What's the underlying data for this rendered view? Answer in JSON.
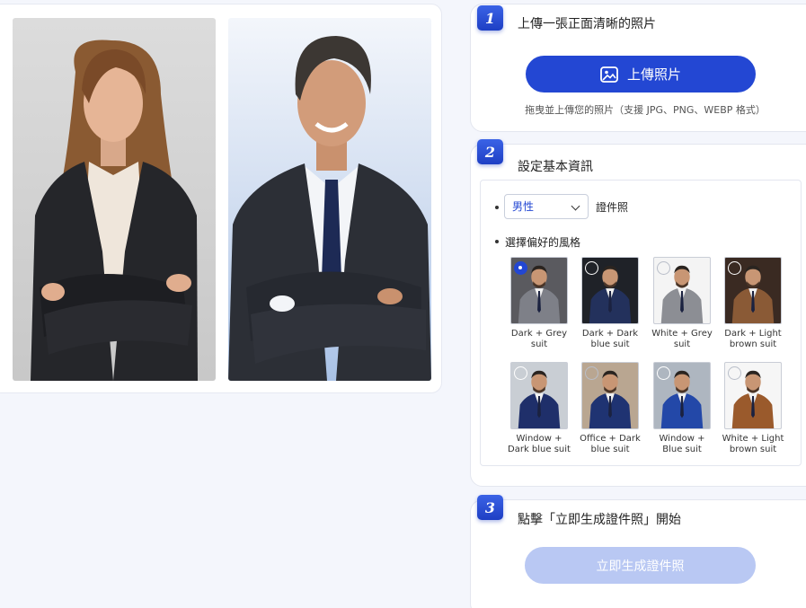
{
  "step1": {
    "number": "1",
    "title": "上傳一張正面清晰的照片",
    "upload_button": "上傳照片",
    "hint": "拖曳並上傳您的照片（支援 JPG、PNG、WEBP 格式）"
  },
  "step2": {
    "number": "2",
    "title": "設定基本資訊",
    "gender_selected": "男性",
    "id_photo_label": "證件照",
    "style_label": "選擇偏好的風格",
    "styles": [
      {
        "line1": "Dark + Grey",
        "line2": "suit",
        "bg": "#5a5a5f",
        "suit": "#7e8088",
        "selected": true
      },
      {
        "line1": "Dark + Dark",
        "line2": "blue suit",
        "bg": "#1f2228",
        "suit": "#23315c",
        "selected": false
      },
      {
        "line1": "White + Grey",
        "line2": "suit",
        "bg": "#f4f4f4",
        "suit": "#8c8e94",
        "selected": false
      },
      {
        "line1": "Dark + Light",
        "line2": "brown suit",
        "bg": "#3a2a22",
        "suit": "#8a5a36",
        "selected": false
      },
      {
        "line1": "Window +",
        "line2": "Dark blue suit",
        "bg": "#c9ced4",
        "suit": "#1f2f6a",
        "selected": false
      },
      {
        "line1": "Office + Dark",
        "line2": "blue suit",
        "bg": "#b9a691",
        "suit": "#1f3372",
        "selected": false
      },
      {
        "line1": "Window +",
        "line2": "Blue suit",
        "bg": "#aeb6c0",
        "suit": "#2348a8",
        "selected": false
      },
      {
        "line1": "White + Light",
        "line2": "brown suit",
        "bg": "#f6f6f6",
        "suit": "#9a5a2c",
        "selected": false
      }
    ]
  },
  "step3": {
    "number": "3",
    "title": "點擊「立即生成證件照」開始",
    "generate_button": "立即生成證件照"
  },
  "colors": {
    "accent": "#2347d3",
    "disabled_button": "#b9c8f3",
    "page_bg": "#f4f6fc"
  },
  "icons": {
    "upload": "image-icon",
    "dropdown": "chevron-down-icon"
  }
}
